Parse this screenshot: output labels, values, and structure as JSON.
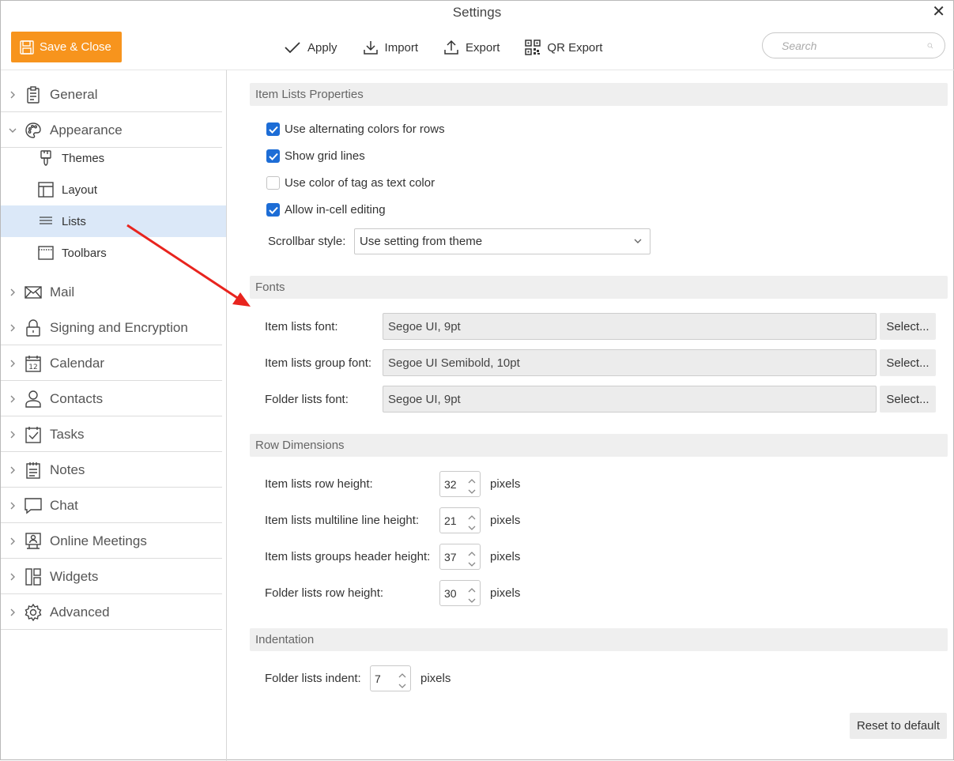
{
  "window": {
    "title": "Settings"
  },
  "toolbar": {
    "save_close": "Save & Close",
    "apply": "Apply",
    "import": "Import",
    "export": "Export",
    "qr_export": "QR Export"
  },
  "search": {
    "placeholder": "Search"
  },
  "sidebar": {
    "items": [
      {
        "label": "General",
        "icon": "clipboard-icon",
        "expanded": false
      },
      {
        "label": "Appearance",
        "icon": "palette-icon",
        "expanded": true
      },
      {
        "label": "Mail",
        "icon": "envelope-icon",
        "expanded": false
      },
      {
        "label": "Signing and Encryption",
        "icon": "lock-icon",
        "expanded": false
      },
      {
        "label": "Calendar",
        "icon": "calendar-icon",
        "expanded": false
      },
      {
        "label": "Contacts",
        "icon": "person-icon",
        "expanded": false
      },
      {
        "label": "Tasks",
        "icon": "task-check-icon",
        "expanded": false
      },
      {
        "label": "Notes",
        "icon": "notes-icon",
        "expanded": false
      },
      {
        "label": "Chat",
        "icon": "chat-bubble-icon",
        "expanded": false
      },
      {
        "label": "Online Meetings",
        "icon": "meeting-icon",
        "expanded": false
      },
      {
        "label": "Widgets",
        "icon": "widgets-icon",
        "expanded": false
      },
      {
        "label": "Advanced",
        "icon": "gear-icon",
        "expanded": false
      }
    ],
    "appearance_children": [
      {
        "label": "Themes",
        "icon": "brush-icon"
      },
      {
        "label": "Layout",
        "icon": "layout-icon"
      },
      {
        "label": "Lists",
        "icon": "lists-icon",
        "selected": true
      },
      {
        "label": "Toolbars",
        "icon": "toolbar-icon"
      }
    ]
  },
  "sections": {
    "item_lists_properties": {
      "title": "Item Lists Properties",
      "checkboxes": [
        {
          "label": "Use alternating colors for rows",
          "checked": true
        },
        {
          "label": "Show grid lines",
          "checked": true
        },
        {
          "label": "Use color of tag as text color",
          "checked": false
        },
        {
          "label": "Allow in-cell editing",
          "checked": true
        }
      ],
      "scrollbar_label": "Scrollbar style:",
      "scrollbar_value": "Use setting from theme"
    },
    "fonts": {
      "title": "Fonts",
      "rows": [
        {
          "label": "Item lists font:",
          "value": "Segoe UI, 9pt",
          "button": "Select..."
        },
        {
          "label": "Item lists group font:",
          "value": "Segoe UI Semibold, 10pt",
          "button": "Select..."
        },
        {
          "label": "Folder lists font:",
          "value": "Segoe UI, 9pt",
          "button": "Select..."
        }
      ]
    },
    "row_dimensions": {
      "title": "Row Dimensions",
      "rows": [
        {
          "label": "Item lists row height:",
          "value": "32",
          "unit": "pixels"
        },
        {
          "label": "Item lists multiline line height:",
          "value": "21",
          "unit": "pixels"
        },
        {
          "label": "Item lists groups header height:",
          "value": "37",
          "unit": "pixels"
        },
        {
          "label": "Folder lists row height:",
          "value": "30",
          "unit": "pixels"
        }
      ]
    },
    "indentation": {
      "title": "Indentation",
      "label": "Folder lists indent:",
      "value": "7",
      "unit": "pixels"
    }
  },
  "footer": {
    "reset": "Reset to default"
  },
  "colors": {
    "accent": "#f7941d",
    "checkbox": "#1d6dd6",
    "selection": "#dbe8f8",
    "annotation_arrow": "#e8241e"
  }
}
